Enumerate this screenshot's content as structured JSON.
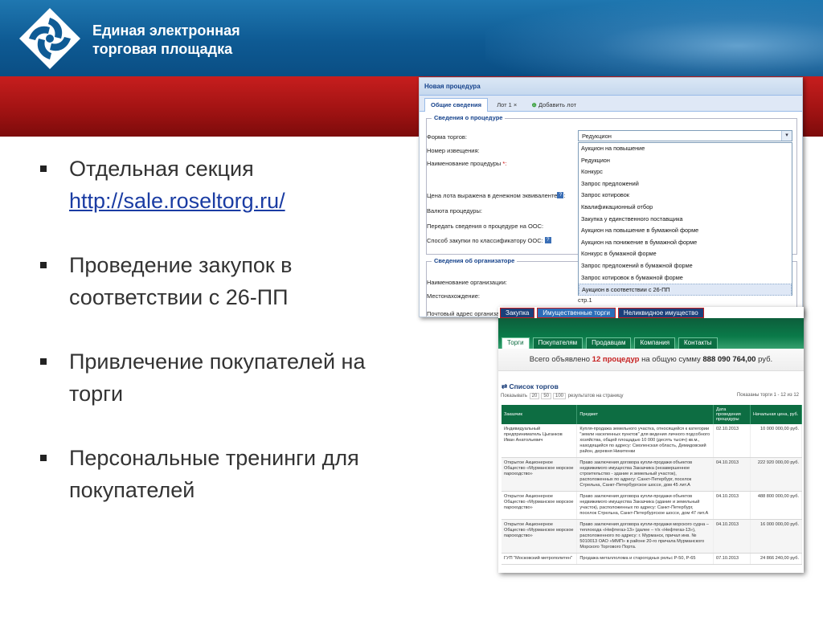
{
  "header": {
    "brand_line1": "Единая электронная",
    "brand_line2": "торговая площадка",
    "colors": {
      "header_blue": "#0e5a93",
      "band_red": "#9e1212"
    }
  },
  "bullets": {
    "b1_text": "Отдельная секция",
    "b1_link": "http://sale.roseltorg.ru/",
    "b2_line1": "Проведение закупок в",
    "b2_line2": "соответствии с 26-ПП",
    "b3_line1": "Привлечение покупателей на",
    "b3_line2": "торги",
    "b4_line1": "Персональные  тренинги для",
    "b4_line2": "покупателей"
  },
  "procedure_form": {
    "window_title": "Новая процедура",
    "tabs": [
      "Общие сведения",
      "Лот 1",
      "Добавить лот"
    ],
    "section1_legend": "Сведения о процедуре",
    "labels": {
      "form_type": "Форма торгов:",
      "notice_number": "Номер извещения:",
      "procedure_name": "Наименование процедуры",
      "price_equiv": "Цена лота выражена в денежном эквиваленте",
      "currency": "Валюта процедуры:",
      "send_oos": "Передать сведения о процедуре на ООС:",
      "method_oos": "Способ закупки по классификатору ООС:"
    },
    "select_value": "Редукцион",
    "dropdown_options": [
      "Аукцион на повышение",
      "Редукцион",
      "Конкурс",
      "Запрос предложений",
      "Запрос котировок",
      "Квалификационный отбор",
      "Закупка у единственного поставщика",
      "Аукцион на повышение в бумажной форме",
      "Аукцион на понижение в бумажной форме",
      "Конкурс в бумажной форме",
      "Запрос предложений в бумажной форме",
      "Запрос котировок в бумажной форме",
      "Аукцион в соответствии с 26-ПП"
    ],
    "section2_legend": "Сведения об организаторе",
    "org_labels": {
      "org_name": "Наименование организации:",
      "location": "Местонахождение:",
      "postal": "Почтовый адрес организа"
    },
    "extra_text": "стр.1"
  },
  "trading_site": {
    "top_tabs": [
      "Закупка",
      "Имущественные торги",
      "Неликвидное имущество"
    ],
    "sub_tabs": [
      "Торги",
      "Покупателям",
      "Продавцам",
      "Компания",
      "Контакты"
    ],
    "announce_prefix": "Всего объявлено",
    "announce_count": "12 процедур",
    "announce_mid": "на общую сумму",
    "announce_sum": "888 090 764,00",
    "announce_currency": "руб.",
    "list_title": "Список торгов",
    "paging_left": "Показывать",
    "paging_opts": [
      "20",
      "50",
      "100"
    ],
    "paging_suffix": "результатов на страницу",
    "paging_right": "Показаны торги 1 - 12 из 12",
    "table_headers": [
      "Заказчик",
      "Предмет",
      "Дата проведения процедуры",
      "Начальная цена, руб."
    ],
    "rows": [
      {
        "customer": "Индивидуальный предприниматель Цыганков Иван Анатольевич",
        "subject": "Купля-продажа земельного участка, относящейся к категории \"земли населенных пунктов\" для ведения личного подсобного хозяйства, общей площадью 10 000 (десять тысяч) кв.м., находящийся по адресу: Смоленская область, Демидовский район, деревня Никитенки",
        "date": "02.10.2013",
        "price": "10 000 000,00 руб."
      },
      {
        "customer": "Открытое Акционерное Общество «Мурманское морское пароходство»",
        "subject": "Право заключения договора купли-продажи объектов недвижимого имущества Заказчика (незавершенное строительство - здание и земельный участок), расположенных по адресу: Санкт-Петербург, поселок Стрельна, Санкт-Петербургское шоссе, дом 45 лит.А",
        "date": "04.10.2013",
        "price": "222 920 000,00 руб."
      },
      {
        "customer": "Открытое Акционерное Общество «Мурманское морское пароходство»",
        "subject": "Право заключения договора купли-продажи объектов недвижимого имущества Заказчика (здание и земельный участок), расположенных по адресу: Санкт-Петербург, поселок Стрельна, Санкт-Петербургское шоссе, дом 47 лит.А",
        "date": "04.10.2013",
        "price": "488 800 000,00 руб."
      },
      {
        "customer": "Открытое Акционерное Общество «Мурманское морское пароходство»",
        "subject": "Право заключения договора купли-продажи морского судна – теплохода «Нефтегаз-13» (далее – т/х «Нефтегаз-13»), расположенного по адресу: г. Мурманск, причал инв. № 5010013 ОАО «ММП» в районе 20-го причала Мурманского Морского Торгового Порта.",
        "date": "04.10.2013",
        "price": "16 000 000,00 руб."
      },
      {
        "customer": "ГУП \"Московский метрополитен\"",
        "subject": "Продажа металлолома и старогодных рельс Р-50, Р-65",
        "date": "07.10.2013",
        "price": "24 866 240,00 руб."
      }
    ]
  }
}
